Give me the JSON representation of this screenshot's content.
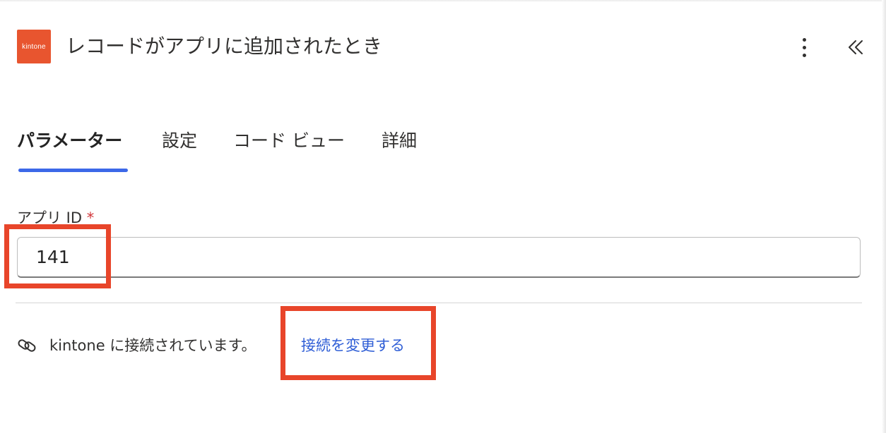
{
  "header": {
    "logo_text": "kintone",
    "title": "レコードがアプリに追加されたとき",
    "more_icon": "more-vertical-icon",
    "collapse_icon": "double-chevron-left-icon"
  },
  "tabs": [
    {
      "label": "パラメーター",
      "active": true
    },
    {
      "label": "設定",
      "active": false
    },
    {
      "label": "コード ビュー",
      "active": false
    },
    {
      "label": "詳細",
      "active": false
    }
  ],
  "form": {
    "app_id_label": "アプリ ID",
    "required_mark": "*",
    "app_id_value": "141"
  },
  "connection": {
    "icon": "link-icon",
    "status_text": "kintone に接続されています。",
    "change_link": "接続を変更する"
  },
  "colors": {
    "brand": "#e8552f",
    "accent": "#3c68e8",
    "link": "#2f5ed6",
    "highlight": "#e8452a",
    "required": "#d13438"
  }
}
